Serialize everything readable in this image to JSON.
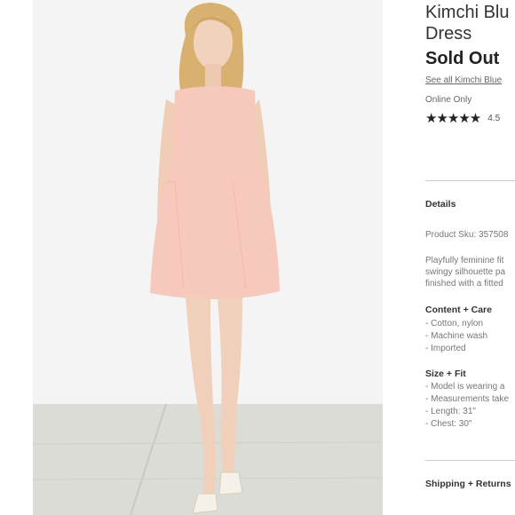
{
  "product": {
    "title_line1": "Kimchi Blu",
    "title_line2": "Dress",
    "status": "Sold Out",
    "see_all_link": "See all Kimchi Blue",
    "availability": "Online Only",
    "rating_stars": "★★★★★",
    "rating_value": "4.5"
  },
  "details": {
    "heading": "Details",
    "sku": "Product Sku: 357508",
    "description": [
      "Playfully feminine fit",
      "swingy silhouette pa",
      "finished with a fitted"
    ]
  },
  "content_care": {
    "heading": "Content + Care",
    "items": [
      "- Cotton, nylon",
      "- Machine wash",
      "- Imported"
    ]
  },
  "size_fit": {
    "heading": "Size + Fit",
    "items": [
      "- Model is wearing a",
      "- Measurements take",
      "- Length: 31\"",
      "- Chest: 30\""
    ]
  },
  "shipping": {
    "heading": "Shipping + Returns"
  },
  "colors": {
    "dress": "#f7c9bd",
    "background": "#f4f4f4",
    "floor": "#dcdcd7"
  }
}
